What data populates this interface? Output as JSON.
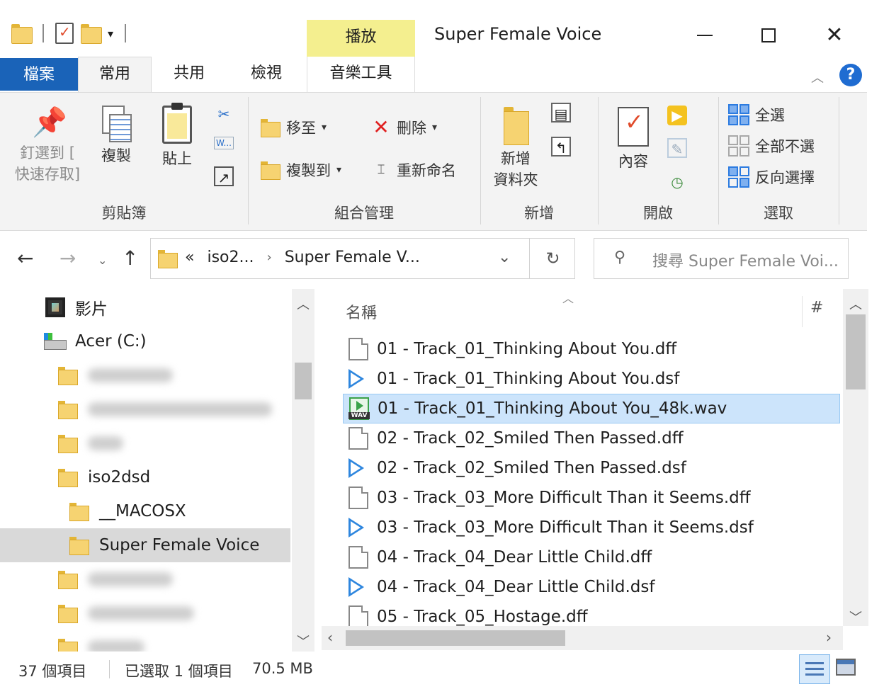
{
  "window": {
    "title": "Super Female Voice",
    "context_tab": "播放",
    "minimize": "",
    "maximize": "",
    "close": "✕"
  },
  "tabs": {
    "file": "檔案",
    "home": "常用",
    "share": "共用",
    "view": "檢視",
    "music_tools": "音樂工具"
  },
  "ribbon": {
    "clipboard": {
      "label": "剪貼簿",
      "pin_line1": "釘選到 [",
      "pin_line2": "快速存取]",
      "copy": "複製",
      "paste": "貼上"
    },
    "organize": {
      "label": "組合管理",
      "move_to": "移至",
      "copy_to": "複製到",
      "delete": "刪除",
      "rename": "重新命名"
    },
    "new": {
      "label": "新增",
      "new_folder_line1": "新增",
      "new_folder_line2": "資料夾"
    },
    "open": {
      "label": "開啟",
      "properties": "內容"
    },
    "select": {
      "label": "選取",
      "select_all": "全選",
      "select_none": "全部不選",
      "invert": "反向選擇"
    }
  },
  "address": {
    "chevrons": "«",
    "crumbs": [
      "iso2...",
      "Super Female V..."
    ],
    "separator": "›"
  },
  "search": {
    "placeholder": "搜尋 Super Female Voi..."
  },
  "nav_pane": {
    "items": [
      {
        "label": "影片",
        "icon": "film-icon"
      },
      {
        "label": "Acer (C:)",
        "icon": "drive-icon"
      },
      {
        "label": "",
        "blurred": true
      },
      {
        "label": "",
        "blurred": true
      },
      {
        "label": "",
        "blurred": true
      },
      {
        "label": "iso2dsd",
        "icon": "folder-icon"
      },
      {
        "label": "__MACOSX",
        "icon": "folder-icon"
      },
      {
        "label": "Super Female Voice",
        "icon": "folder-icon",
        "selected": true
      },
      {
        "label": "",
        "blurred": true
      },
      {
        "label": "",
        "blurred": true
      },
      {
        "label": "",
        "blurred": true
      }
    ]
  },
  "file_list": {
    "columns": {
      "name": "名稱",
      "number": "#"
    },
    "rows": [
      {
        "name": "01 - Track_01_Thinking About You.dff",
        "icon": "document-icon"
      },
      {
        "name": "01 - Track_01_Thinking About You.dsf",
        "icon": "play-icon"
      },
      {
        "name": "01 - Track_01_Thinking About You_48k.wav",
        "icon": "wav-icon",
        "selected": true
      },
      {
        "name": "02 - Track_02_Smiled Then Passed.dff",
        "icon": "document-icon"
      },
      {
        "name": "02 - Track_02_Smiled Then Passed.dsf",
        "icon": "play-icon"
      },
      {
        "name": "03 - Track_03_More Difficult Than it Seems.dff",
        "icon": "document-icon"
      },
      {
        "name": "03 - Track_03_More Difficult Than it Seems.dsf",
        "icon": "play-icon"
      },
      {
        "name": "04 - Track_04_Dear Little Child.dff",
        "icon": "document-icon"
      },
      {
        "name": "04 - Track_04_Dear Little Child.dsf",
        "icon": "play-icon"
      },
      {
        "name": "05 - Track_05_Hostage.dff",
        "icon": "document-icon"
      }
    ]
  },
  "status": {
    "count": "37 個項目",
    "selected": "已選取 1 個項目",
    "size": "70.5 MB"
  },
  "colors": {
    "accent": "#1a63b8",
    "context_tab": "#f4ef8f",
    "selection": "#cce4fb"
  }
}
